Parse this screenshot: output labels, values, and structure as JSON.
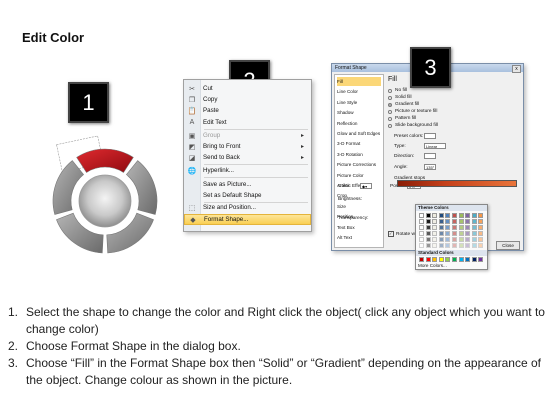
{
  "title": "Edit Color",
  "badges": [
    "1",
    "2",
    "3"
  ],
  "context_menu": {
    "items": [
      {
        "label": "Cut",
        "icon": "scissors-icon",
        "glyph": "✂",
        "disabled": false,
        "submenu": false
      },
      {
        "label": "Copy",
        "icon": "copy-icon",
        "glyph": "❐",
        "disabled": false,
        "submenu": false
      },
      {
        "label": "Paste",
        "icon": "paste-icon",
        "glyph": "📋",
        "disabled": false,
        "submenu": false
      },
      {
        "label": "Edit Text",
        "icon": "edit-text-icon",
        "glyph": "A",
        "disabled": false,
        "submenu": false
      },
      {
        "label": "Group",
        "icon": "group-icon",
        "glyph": "▣",
        "disabled": true,
        "submenu": true
      },
      {
        "label": "Bring to Front",
        "icon": "bring-front-icon",
        "glyph": "◩",
        "disabled": false,
        "submenu": true
      },
      {
        "label": "Send to Back",
        "icon": "send-back-icon",
        "glyph": "◪",
        "disabled": false,
        "submenu": true
      },
      {
        "label": "Hyperlink...",
        "icon": "hyperlink-icon",
        "glyph": "🌐",
        "disabled": false,
        "submenu": false
      },
      {
        "label": "Save as Picture...",
        "icon": "",
        "glyph": "",
        "disabled": false,
        "submenu": false
      },
      {
        "label": "Set as Default Shape",
        "icon": "",
        "glyph": "",
        "disabled": false,
        "submenu": false
      },
      {
        "label": "Size and Position...",
        "icon": "size-icon",
        "glyph": "⬚",
        "disabled": false,
        "submenu": false
      },
      {
        "label": "Format Shape...",
        "icon": "format-shape-icon",
        "glyph": "◆",
        "disabled": false,
        "submenu": false,
        "highlighted": true
      }
    ]
  },
  "dialog": {
    "title": "Format Shape",
    "close_label": "x",
    "nav": [
      "Fill",
      "Line Color",
      "Line Style",
      "Shadow",
      "Reflection",
      "Glow and Soft Edges",
      "3-D Format",
      "3-D Rotation",
      "Picture Corrections",
      "Picture Color",
      "Artistic Effects",
      "Crop",
      "Size",
      "Position",
      "Text Box",
      "Alt Text"
    ],
    "fill_heading": "Fill",
    "fill_options": [
      {
        "label": "No fill",
        "selected": false
      },
      {
        "label": "Solid fill",
        "selected": false
      },
      {
        "label": "Gradient fill",
        "selected": true
      },
      {
        "label": "Picture or texture fill",
        "selected": false
      },
      {
        "label": "Pattern fill",
        "selected": false
      },
      {
        "label": "Slide background fill",
        "selected": false
      }
    ],
    "fields": [
      {
        "label": "Preset colors:",
        "value": ""
      },
      {
        "label": "Type:",
        "value": "Linear"
      },
      {
        "label": "Direction:",
        "value": ""
      },
      {
        "label": "Angle:",
        "value": "135°"
      },
      {
        "label": "Gradient stops",
        "value": ""
      }
    ],
    "color_label": "Color",
    "position_label": "Position:",
    "position_value": "0%",
    "brightness_label": "Brightness:",
    "transparency_label": "Transparency:",
    "rotate_label": "Rotate with shape",
    "close_button": "Close"
  },
  "picker": {
    "theme_heading": "Theme Colors",
    "standard_heading": "Standard Colors",
    "more_label": "More Colors...",
    "theme_top": [
      "#ffffff",
      "#000000",
      "#eeece1",
      "#1f497d",
      "#4f81bd",
      "#c0504d",
      "#9bbb59",
      "#8064a2",
      "#4bacc6",
      "#f79646"
    ],
    "standard": [
      "#c00000",
      "#ff0000",
      "#ffc000",
      "#ffff00",
      "#92d050",
      "#00b050",
      "#00b0f0",
      "#0070c0",
      "#002060",
      "#7030a0"
    ]
  },
  "steps": [
    {
      "num": "1.",
      "text": "Select the shape to change the color and Right click the object( click any object which you want to change color)"
    },
    {
      "num": "2.",
      "text": "Choose Format Shape in the dialog box."
    },
    {
      "num": "3.",
      "text": "Choose “Fill” in the Format Shape box then “Solid” or “Gradient” depending on the appearance of the object. Change colour as shown in the picture."
    }
  ],
  "colors": {
    "accent_red": "#c0131b",
    "segment_gray": "#8c8c8c",
    "highlight": "#f9cf53"
  }
}
